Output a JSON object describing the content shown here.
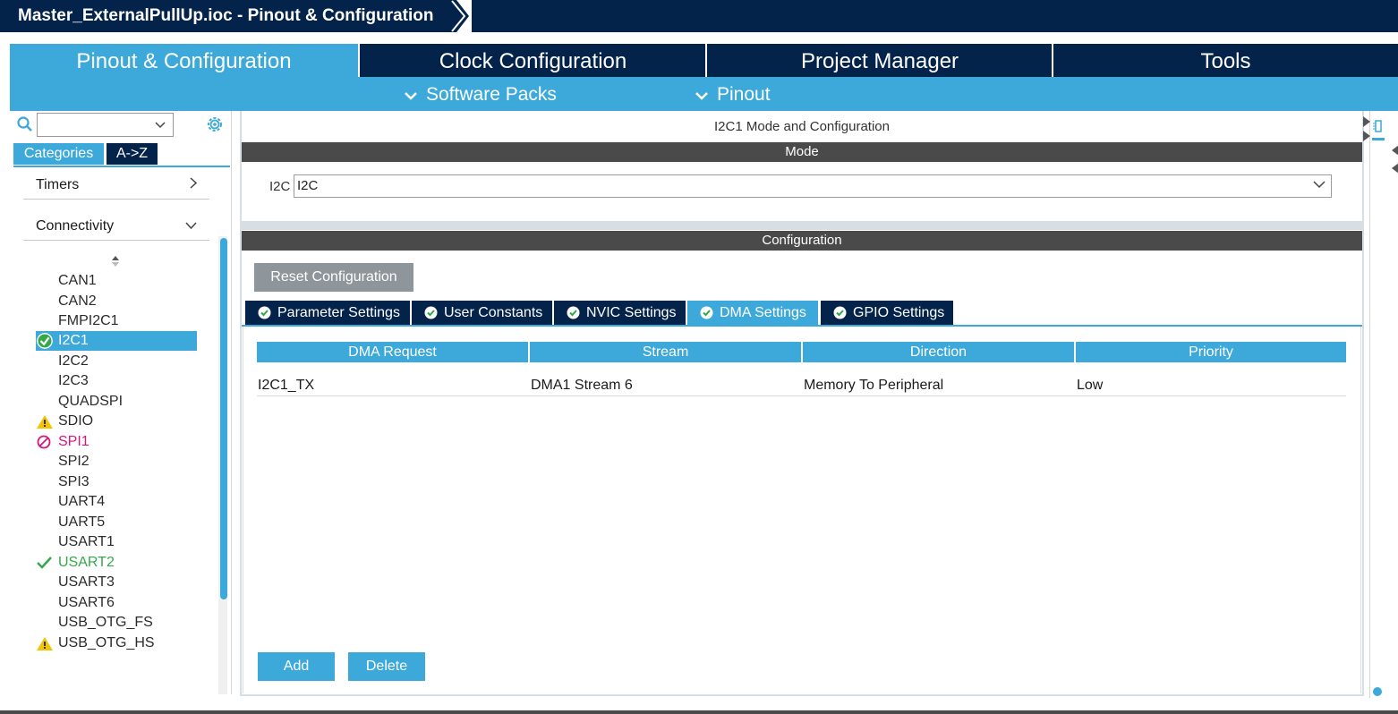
{
  "window": {
    "title": "Master_ExternalPullUp.ioc - Pinout & Configuration"
  },
  "tabs": [
    {
      "label": "Pinout & Configuration",
      "active": true
    },
    {
      "label": "Clock Configuration",
      "active": false
    },
    {
      "label": "Project Manager",
      "active": false
    },
    {
      "label": "Tools",
      "active": false
    }
  ],
  "subbar": {
    "software_packs": "Software Packs",
    "pinout": "Pinout"
  },
  "sidebar": {
    "search_value": "",
    "tab_categories": "Categories",
    "tab_az": "A->Z",
    "sections": {
      "timers": "Timers",
      "connectivity": "Connectivity"
    },
    "peripherals": [
      {
        "label": "CAN1",
        "status": "none"
      },
      {
        "label": "CAN2",
        "status": "none"
      },
      {
        "label": "FMPI2C1",
        "status": "none"
      },
      {
        "label": "I2C1",
        "status": "selected"
      },
      {
        "label": "I2C2",
        "status": "none"
      },
      {
        "label": "I2C3",
        "status": "none"
      },
      {
        "label": "QUADSPI",
        "status": "none"
      },
      {
        "label": "SDIO",
        "status": "warning"
      },
      {
        "label": "SPI1",
        "status": "disabled"
      },
      {
        "label": "SPI2",
        "status": "none"
      },
      {
        "label": "SPI3",
        "status": "none"
      },
      {
        "label": "UART4",
        "status": "none"
      },
      {
        "label": "UART5",
        "status": "none"
      },
      {
        "label": "USART1",
        "status": "none"
      },
      {
        "label": "USART2",
        "status": "configured"
      },
      {
        "label": "USART3",
        "status": "none"
      },
      {
        "label": "USART6",
        "status": "none"
      },
      {
        "label": "USB_OTG_FS",
        "status": "none"
      },
      {
        "label": "USB_OTG_HS",
        "status": "warning"
      }
    ]
  },
  "mode_panel": {
    "title": "I2C1 Mode and Configuration",
    "mode_header": "Mode",
    "i2c_label": "I2C",
    "i2c_value": "I2C"
  },
  "config_panel": {
    "header": "Configuration",
    "reset_label": "Reset Configuration",
    "tabs": [
      {
        "label": "Parameter Settings",
        "active": false
      },
      {
        "label": "User Constants",
        "active": false
      },
      {
        "label": "NVIC Settings",
        "active": false
      },
      {
        "label": "DMA Settings",
        "active": true
      },
      {
        "label": "GPIO Settings",
        "active": false
      }
    ],
    "dma_table": {
      "headers": [
        "DMA Request",
        "Stream",
        "Direction",
        "Priority"
      ],
      "rows": [
        [
          "I2C1_TX",
          "DMA1 Stream 6",
          "Memory To Peripheral",
          "Low"
        ]
      ]
    },
    "add_label": "Add",
    "delete_label": "Delete"
  },
  "colors": {
    "navy": "#03234b",
    "accent": "#3ca9da",
    "warning": "#f5c400",
    "error": "#d6157f",
    "ok": "#35a84a"
  }
}
